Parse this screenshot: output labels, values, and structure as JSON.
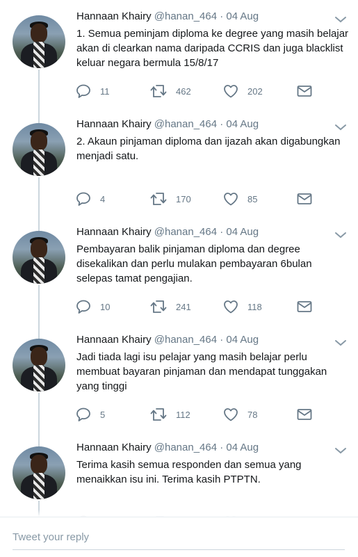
{
  "tweets": [
    {
      "name": "Hannaan Khairy",
      "handle": "@hanan_464",
      "date": "04 Aug",
      "text": "1. Semua peminjam diploma ke degree yang masih belajar akan di clearkan nama daripada CCRIS dan juga blacklist keluar negara bermula 15/8/17",
      "replies": "11",
      "retweets": "462",
      "likes": "202"
    },
    {
      "name": "Hannaan Khairy",
      "handle": "@hanan_464",
      "date": "04 Aug",
      "text": "2. Akaun pinjaman diploma dan ijazah akan digabungkan menjadi satu.",
      "replies": "4",
      "retweets": "170",
      "likes": "85"
    },
    {
      "name": "Hannaan Khairy",
      "handle": "@hanan_464",
      "date": "04 Aug",
      "text": "Pembayaran balik pinjaman diploma dan degree disekalikan dan perlu mulakan pembayaran 6bulan selepas tamat pengajian.",
      "replies": "10",
      "retweets": "241",
      "likes": "118"
    },
    {
      "name": "Hannaan Khairy",
      "handle": "@hanan_464",
      "date": "04 Aug",
      "text": "Jadi tiada lagi isu pelajar yang masih belajar perlu membuat bayaran pinjaman dan mendapat tunggakan yang tinggi",
      "replies": "5",
      "retweets": "112",
      "likes": "78"
    },
    {
      "name": "Hannaan Khairy",
      "handle": "@hanan_464",
      "date": "04 Aug",
      "text": "Terima kasih semua responden dan semua yang menaikkan isu ini. Terima kasih PTPTN.",
      "replies": "",
      "retweets": "",
      "likes": ""
    }
  ],
  "meta_separator": "·",
  "reply_box": {
    "placeholder": "Tweet your reply"
  },
  "colors": {
    "text": "#14171a",
    "secondary": "#657786",
    "thread_line": "#ccd6dd"
  },
  "icons": [
    "reply-icon",
    "retweet-icon",
    "like-icon",
    "message-icon",
    "chevron-down-icon"
  ]
}
